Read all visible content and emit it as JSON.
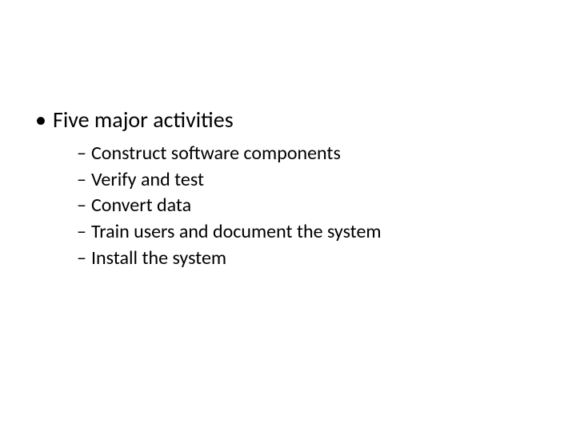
{
  "slide": {
    "level1_bullet": "•",
    "level1_text": "Five major activities",
    "level2_dash": "–",
    "items": [
      "Construct software components",
      "Verify and test",
      "Convert data",
      "Train users and document the system",
      "Install the system"
    ]
  }
}
